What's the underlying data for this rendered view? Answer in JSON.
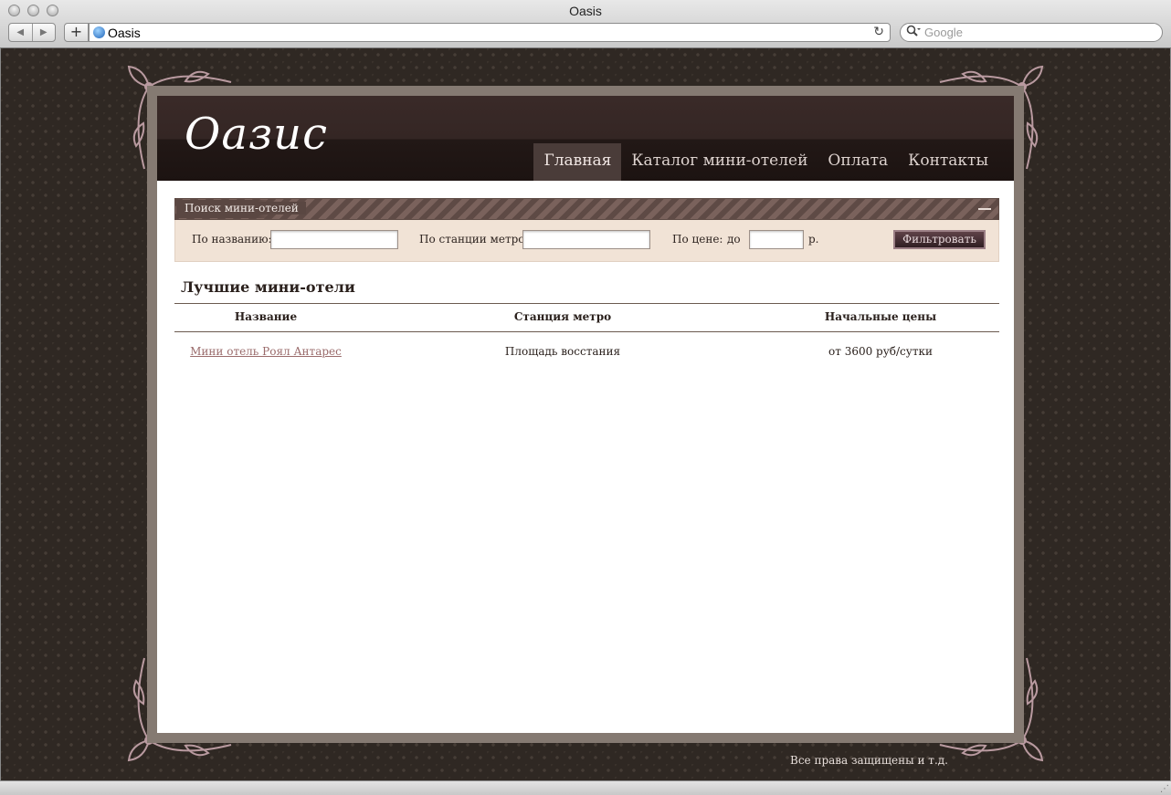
{
  "browser": {
    "window_title": "Oasis",
    "back_icon": "◀",
    "forward_icon": "▶",
    "add_icon": "+",
    "url": "Oasis",
    "reload_icon": "↻",
    "search_icon": "🔍",
    "search_placeholder": "Google"
  },
  "site": {
    "logo": "Оазис",
    "nav": [
      {
        "label": "Главная",
        "active": true
      },
      {
        "label": "Каталог мини-отелей",
        "active": false
      },
      {
        "label": "Оплата",
        "active": false
      },
      {
        "label": "Контакты",
        "active": false
      }
    ]
  },
  "search_panel": {
    "title": "Поиск мини-отелей",
    "name_label": "По названию:",
    "name_value": "",
    "metro_label": "По станции метро:",
    "metro_value": "",
    "price_label": "По цене:",
    "price_to_label": "до",
    "price_value": "",
    "currency": "р.",
    "filter_button": "Фильтровать"
  },
  "best_hotels": {
    "title": "Лучшие мини-отели",
    "columns": [
      "Название",
      "Станция метро",
      "Начальные цены"
    ],
    "rows": [
      {
        "name": "Мини отель Роял Антарес",
        "metro": "Площадь восстания",
        "price": "от 3600 руб/сутки"
      }
    ]
  },
  "footer": {
    "copyright": "Все права защищены и т.д."
  },
  "colors": {
    "page_bg": "#2f2823",
    "header_bg": "#221816",
    "panel_bg": "#f1e3d6",
    "link": "#9a6b6b"
  }
}
